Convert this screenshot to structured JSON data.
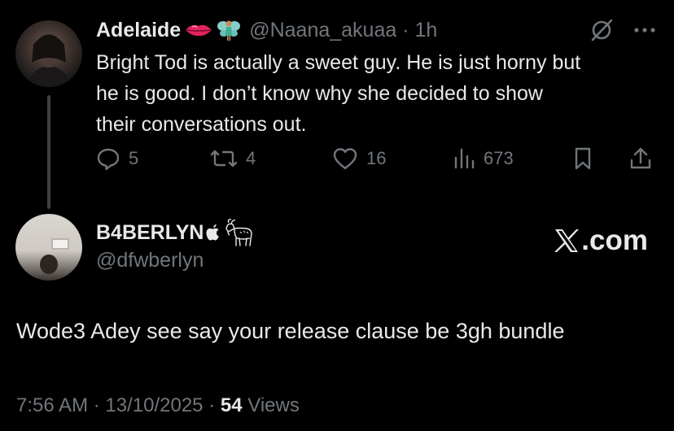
{
  "tweet": {
    "author_name": "Adelaide",
    "handle": "@Naana_akuaa",
    "separator": "·",
    "time": "1h",
    "text_lines": [
      "Bright Tod is actually a sweet guy. He is just horny but",
      "he is good. I don’t know why she decided to show",
      "their conversations out."
    ],
    "icons": {
      "grok": "grok-icon",
      "more": "more-icon"
    },
    "actions": {
      "replies": "5",
      "reposts": "4",
      "likes": "16",
      "views": "673"
    }
  },
  "reply": {
    "author_name": "B4BERLYN",
    "handle": "@dfwberlyn",
    "text": "Wode3 Adey see say your release clause be 3gh bundle",
    "watermark": ".com",
    "footer": {
      "time": "7:56 AM",
      "separator": "·",
      "date": "13/10/2025",
      "views_count": "54",
      "views_label": "Views"
    }
  },
  "colors": {
    "background": "#000000",
    "text": "#e7e9ea",
    "muted": "#71767b",
    "thread_line": "#3e4144"
  }
}
